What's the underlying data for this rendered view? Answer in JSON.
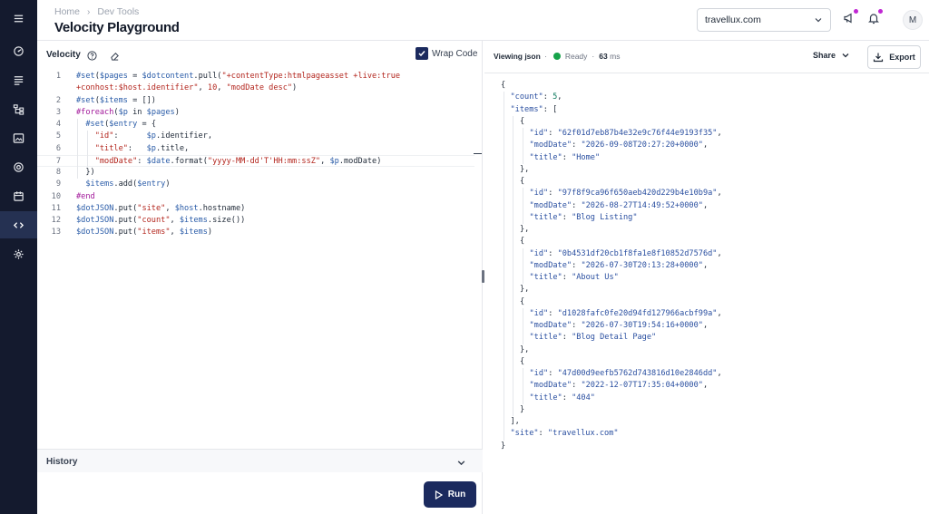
{
  "sidebar": {
    "items": [
      {
        "icon": "menu-icon"
      },
      {
        "icon": "dashboard-icon"
      },
      {
        "icon": "content-icon"
      },
      {
        "icon": "site-tree-icon"
      },
      {
        "icon": "media-icon"
      },
      {
        "icon": "target-icon"
      },
      {
        "icon": "calendar-icon"
      },
      {
        "icon": "code-icon",
        "active": true
      },
      {
        "icon": "gear-icon"
      }
    ]
  },
  "header": {
    "breadcrumb": [
      "Home",
      "Dev Tools"
    ],
    "title": "Velocity Playground",
    "site_select": "travellux.com",
    "avatar": "M"
  },
  "editor": {
    "title": "Velocity",
    "wrap_code_label": "Wrap Code",
    "line_numbers": [
      "1",
      "",
      "2",
      "3",
      "4",
      "5",
      "6",
      "7",
      "8",
      "9",
      "10",
      "11",
      "12",
      "13"
    ],
    "code": [
      {
        "tokens": [
          [
            "vr",
            "#set"
          ],
          [
            "pl",
            "("
          ],
          [
            "vr",
            "$pages"
          ],
          [
            "pl",
            " = "
          ],
          [
            "vr",
            "$dotcontent"
          ],
          [
            "pl",
            ".pull("
          ],
          [
            "st",
            "\"+contentType:htmlpageasset +live:true"
          ]
        ]
      },
      {
        "tokens": [
          [
            "st",
            "+conhost:$host.identifier\""
          ],
          [
            "pl",
            ", "
          ],
          [
            "st",
            "10"
          ],
          [
            "pl",
            ", "
          ],
          [
            "st",
            "\"modDate desc\""
          ],
          [
            "pl",
            ")"
          ]
        ]
      },
      {
        "tokens": [
          [
            "vr",
            "#set"
          ],
          [
            "pl",
            "("
          ],
          [
            "vr",
            "$items"
          ],
          [
            "pl",
            " = [])"
          ]
        ]
      },
      {
        "tokens": [
          [
            "kw",
            "#foreach"
          ],
          [
            "pl",
            "("
          ],
          [
            "vr",
            "$p"
          ],
          [
            "pl",
            " in "
          ],
          [
            "vr",
            "$pages"
          ],
          [
            "pl",
            ")"
          ]
        ]
      },
      {
        "tokens": [
          [
            "pl",
            "  "
          ],
          [
            "vr",
            "#set"
          ],
          [
            "pl",
            "("
          ],
          [
            "vr",
            "$entry"
          ],
          [
            "pl",
            " = {"
          ]
        ]
      },
      {
        "tokens": [
          [
            "pl",
            "    "
          ],
          [
            "st",
            "\"id\""
          ],
          [
            "pl",
            ":      "
          ],
          [
            "vr",
            "$p"
          ],
          [
            "pl",
            ".identifier,"
          ]
        ]
      },
      {
        "tokens": [
          [
            "pl",
            "    "
          ],
          [
            "st",
            "\"title\""
          ],
          [
            "pl",
            ":   "
          ],
          [
            "vr",
            "$p"
          ],
          [
            "pl",
            ".title,"
          ]
        ]
      },
      {
        "tokens": [
          [
            "pl",
            "    "
          ],
          [
            "st",
            "\"modDate\""
          ],
          [
            "pl",
            ": "
          ],
          [
            "vr",
            "$date"
          ],
          [
            "pl",
            ".format("
          ],
          [
            "st",
            "\"yyyy-MM-dd'T'HH:mm:ssZ\""
          ],
          [
            "pl",
            ", "
          ],
          [
            "vr",
            "$p"
          ],
          [
            "pl",
            ".modDate)"
          ]
        ]
      },
      {
        "tokens": [
          [
            "pl",
            "  })"
          ]
        ]
      },
      {
        "tokens": [
          [
            "pl",
            "  "
          ],
          [
            "vr",
            "$items"
          ],
          [
            "pl",
            ".add("
          ],
          [
            "vr",
            "$entry"
          ],
          [
            "pl",
            ")"
          ]
        ]
      },
      {
        "tokens": [
          [
            "kw",
            "#end"
          ]
        ]
      },
      {
        "tokens": [
          [
            "vr",
            "$dotJSON"
          ],
          [
            "pl",
            ".put("
          ],
          [
            "st",
            "\"site\""
          ],
          [
            "pl",
            ", "
          ],
          [
            "vr",
            "$host"
          ],
          [
            "pl",
            ".hostname)"
          ]
        ]
      },
      {
        "tokens": [
          [
            "vr",
            "$dotJSON"
          ],
          [
            "pl",
            ".put("
          ],
          [
            "st",
            "\"count\""
          ],
          [
            "pl",
            ", "
          ],
          [
            "vr",
            "$items"
          ],
          [
            "pl",
            ".size())"
          ]
        ]
      },
      {
        "tokens": [
          [
            "vr",
            "$dotJSON"
          ],
          [
            "pl",
            ".put("
          ],
          [
            "st",
            "\"items\""
          ],
          [
            "pl",
            ", "
          ],
          [
            "vr",
            "$items"
          ],
          [
            "pl",
            ")"
          ]
        ]
      }
    ]
  },
  "history": {
    "label": "History"
  },
  "run_button": {
    "label": "Run"
  },
  "result": {
    "viewing_label": "Viewing json",
    "status": "Ready",
    "time_ms": "63",
    "time_unit": "ms",
    "share_label": "Share",
    "export_label": "Export",
    "json_lines": [
      {
        "indent": 0,
        "tokens": [
          [
            "jk",
            "{"
          ]
        ]
      },
      {
        "indent": 1,
        "tokens": [
          [
            "js",
            "\"count\""
          ],
          [
            "jk",
            ": "
          ],
          [
            "jn",
            "5"
          ],
          [
            "jk",
            ","
          ]
        ]
      },
      {
        "indent": 1,
        "tokens": [
          [
            "js",
            "\"items\""
          ],
          [
            "jk",
            ": ["
          ]
        ]
      },
      {
        "indent": 2,
        "tokens": [
          [
            "jk",
            "{"
          ]
        ]
      },
      {
        "indent": 3,
        "tokens": [
          [
            "js",
            "\"id\""
          ],
          [
            "jk",
            ": "
          ],
          [
            "js",
            "\"62f01d7eb87b4e32e9c76f44e9193f35\""
          ],
          [
            "jk",
            ","
          ]
        ]
      },
      {
        "indent": 3,
        "tokens": [
          [
            "js",
            "\"modDate\""
          ],
          [
            "jk",
            ": "
          ],
          [
            "js",
            "\"2026-09-08T20:27:20+0000\""
          ],
          [
            "jk",
            ","
          ]
        ]
      },
      {
        "indent": 3,
        "tokens": [
          [
            "js",
            "\"title\""
          ],
          [
            "jk",
            ": "
          ],
          [
            "js",
            "\"Home\""
          ]
        ]
      },
      {
        "indent": 2,
        "tokens": [
          [
            "jk",
            "},"
          ]
        ]
      },
      {
        "indent": 2,
        "tokens": [
          [
            "jk",
            "{"
          ]
        ]
      },
      {
        "indent": 3,
        "tokens": [
          [
            "js",
            "\"id\""
          ],
          [
            "jk",
            ": "
          ],
          [
            "js",
            "\"97f8f9ca96f650aeb420d229b4e10b9a\""
          ],
          [
            "jk",
            ","
          ]
        ]
      },
      {
        "indent": 3,
        "tokens": [
          [
            "js",
            "\"modDate\""
          ],
          [
            "jk",
            ": "
          ],
          [
            "js",
            "\"2026-08-27T14:49:52+0000\""
          ],
          [
            "jk",
            ","
          ]
        ]
      },
      {
        "indent": 3,
        "tokens": [
          [
            "js",
            "\"title\""
          ],
          [
            "jk",
            ": "
          ],
          [
            "js",
            "\"Blog Listing\""
          ]
        ]
      },
      {
        "indent": 2,
        "tokens": [
          [
            "jk",
            "},"
          ]
        ]
      },
      {
        "indent": 2,
        "tokens": [
          [
            "jk",
            "{"
          ]
        ]
      },
      {
        "indent": 3,
        "tokens": [
          [
            "js",
            "\"id\""
          ],
          [
            "jk",
            ": "
          ],
          [
            "js",
            "\"0b4531df20cb1f8fa1e8f10852d7576d\""
          ],
          [
            "jk",
            ","
          ]
        ]
      },
      {
        "indent": 3,
        "tokens": [
          [
            "js",
            "\"modDate\""
          ],
          [
            "jk",
            ": "
          ],
          [
            "js",
            "\"2026-07-30T20:13:28+0000\""
          ],
          [
            "jk",
            ","
          ]
        ]
      },
      {
        "indent": 3,
        "tokens": [
          [
            "js",
            "\"title\""
          ],
          [
            "jk",
            ": "
          ],
          [
            "js",
            "\"About Us\""
          ]
        ]
      },
      {
        "indent": 2,
        "tokens": [
          [
            "jk",
            "},"
          ]
        ]
      },
      {
        "indent": 2,
        "tokens": [
          [
            "jk",
            "{"
          ]
        ]
      },
      {
        "indent": 3,
        "tokens": [
          [
            "js",
            "\"id\""
          ],
          [
            "jk",
            ": "
          ],
          [
            "js",
            "\"d1028fafc0fe20d94fd127966acbf99a\""
          ],
          [
            "jk",
            ","
          ]
        ]
      },
      {
        "indent": 3,
        "tokens": [
          [
            "js",
            "\"modDate\""
          ],
          [
            "jk",
            ": "
          ],
          [
            "js",
            "\"2026-07-30T19:54:16+0000\""
          ],
          [
            "jk",
            ","
          ]
        ]
      },
      {
        "indent": 3,
        "tokens": [
          [
            "js",
            "\"title\""
          ],
          [
            "jk",
            ": "
          ],
          [
            "js",
            "\"Blog Detail Page\""
          ]
        ]
      },
      {
        "indent": 2,
        "tokens": [
          [
            "jk",
            "},"
          ]
        ]
      },
      {
        "indent": 2,
        "tokens": [
          [
            "jk",
            "{"
          ]
        ]
      },
      {
        "indent": 3,
        "tokens": [
          [
            "js",
            "\"id\""
          ],
          [
            "jk",
            ": "
          ],
          [
            "js",
            "\"47d00d9eefb5762d743816d10e2846dd\""
          ],
          [
            "jk",
            ","
          ]
        ]
      },
      {
        "indent": 3,
        "tokens": [
          [
            "js",
            "\"modDate\""
          ],
          [
            "jk",
            ": "
          ],
          [
            "js",
            "\"2022-12-07T17:35:04+0000\""
          ],
          [
            "jk",
            ","
          ]
        ]
      },
      {
        "indent": 3,
        "tokens": [
          [
            "js",
            "\"title\""
          ],
          [
            "jk",
            ": "
          ],
          [
            "js",
            "\"404\""
          ]
        ]
      },
      {
        "indent": 2,
        "tokens": [
          [
            "jk",
            "}"
          ]
        ]
      },
      {
        "indent": 1,
        "tokens": [
          [
            "jk",
            "],"
          ]
        ]
      },
      {
        "indent": 1,
        "tokens": [
          [
            "js",
            "\"site\""
          ],
          [
            "jk",
            ": "
          ],
          [
            "js",
            "\"travellux.com\""
          ]
        ]
      },
      {
        "indent": 0,
        "tokens": [
          [
            "jk",
            "}"
          ]
        ]
      }
    ]
  },
  "colors": {
    "sidebar_bg": "#141a2e",
    "sidebar_active": "#253152",
    "primary": "#1b2a5e",
    "ready": "#16a34a",
    "notification_dot": "#c026d3"
  }
}
